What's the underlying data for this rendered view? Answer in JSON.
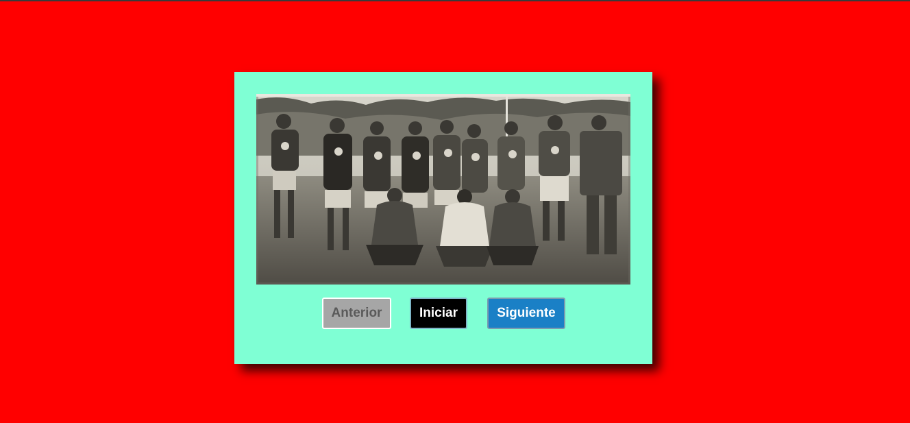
{
  "page": {
    "background_color": "#ff0000",
    "card_color": "#7fffd4"
  },
  "photo": {
    "description_icon": "team-photo-image"
  },
  "controls": {
    "prev_label": "Anterior",
    "start_label": "Iniciar",
    "next_label": "Siguiente",
    "prev_color": "#a6a6a6",
    "start_color": "#000000",
    "next_color": "#1a80c6"
  }
}
